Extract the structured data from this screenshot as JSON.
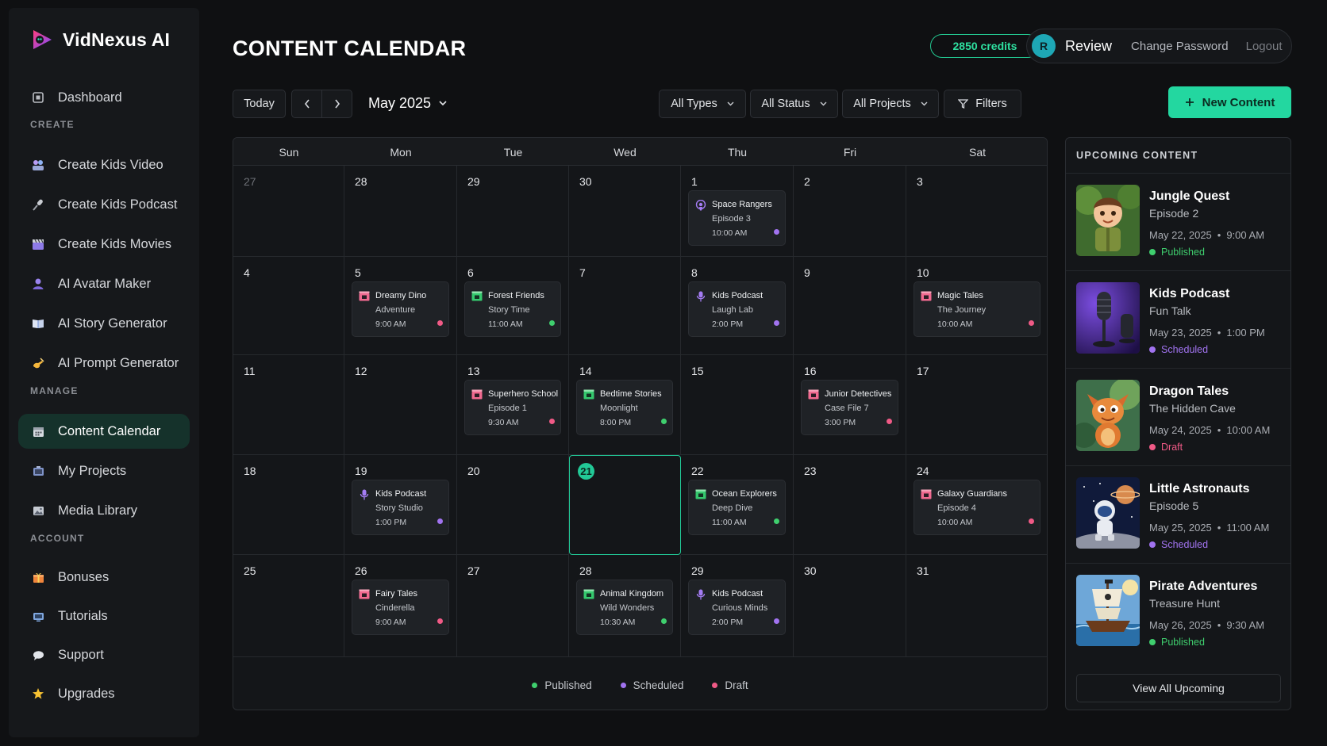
{
  "app": {
    "name": "VidNexus AI"
  },
  "sidebar": {
    "dashboard": {
      "label": "Dashboard",
      "icon": "dashboard-icon"
    },
    "sections": {
      "create": "CREATE",
      "manage": "MANAGE",
      "account": "ACCOUNT"
    },
    "create_items": [
      {
        "label": "Create Kids Video",
        "icon": "kids-video-icon"
      },
      {
        "label": "Create Kids Podcast",
        "icon": "podcast-icon"
      },
      {
        "label": "Create Kids Movies",
        "icon": "clapper-icon"
      },
      {
        "label": "AI Avatar Maker",
        "icon": "avatar-icon"
      },
      {
        "label": "AI Story Generator",
        "icon": "book-icon"
      },
      {
        "label": "AI Prompt Generator",
        "icon": "hand-write-icon"
      }
    ],
    "manage_items": [
      {
        "label": "Content Calendar",
        "icon": "calendar-icon",
        "active": true
      },
      {
        "label": "My Projects",
        "icon": "projects-icon"
      },
      {
        "label": "Media Library",
        "icon": "image-icon"
      }
    ],
    "account_items": [
      {
        "label": "Bonuses",
        "icon": "gift-icon"
      },
      {
        "label": "Tutorials",
        "icon": "tv-icon"
      },
      {
        "label": "Support",
        "icon": "chat-icon"
      },
      {
        "label": "Upgrades",
        "icon": "star-icon"
      }
    ]
  },
  "header": {
    "title": "CONTENT CALENDAR",
    "credits": "2850 credits",
    "avatar_initial": "R",
    "user": "Review",
    "change_password": "Change Password",
    "logout": "Logout"
  },
  "toolbar": {
    "today": "Today",
    "month": "May 2025",
    "types": "All Types",
    "status": "All Status",
    "projects": "All Projects",
    "filters": "Filters",
    "new_content": "New Content"
  },
  "calendar": {
    "weekdays": [
      "Sun",
      "Mon",
      "Tue",
      "Wed",
      "Thu",
      "Fri",
      "Sat"
    ],
    "weeks": [
      [
        "27",
        "28",
        "29",
        "30",
        "1",
        "2",
        "3"
      ],
      [
        "4",
        "5",
        "6",
        "7",
        "8",
        "9",
        "10"
      ],
      [
        "11",
        "12",
        "13",
        "14",
        "15",
        "16",
        "17"
      ],
      [
        "18",
        "19",
        "20",
        "21",
        "22",
        "23",
        "24"
      ],
      [
        "25",
        "26",
        "27",
        "28",
        "29",
        "30",
        "31"
      ]
    ],
    "today": "21",
    "events": [
      {
        "week": 0,
        "day": 4,
        "title": "Space Rangers",
        "subtitle": "Episode 3",
        "time": "10:00 AM",
        "type": "podcast",
        "status": "scheduled"
      },
      {
        "week": 1,
        "day": 1,
        "title": "Dreamy Dino",
        "subtitle": "Adventure",
        "time": "9:00 AM",
        "type": "video",
        "status": "draft"
      },
      {
        "week": 1,
        "day": 2,
        "title": "Forest Friends",
        "subtitle": "Story Time",
        "time": "11:00 AM",
        "type": "story",
        "status": "published"
      },
      {
        "week": 1,
        "day": 4,
        "title": "Kids Podcast",
        "subtitle": "Laugh Lab",
        "time": "2:00 PM",
        "type": "mic",
        "status": "scheduled"
      },
      {
        "week": 1,
        "day": 6,
        "title": "Magic Tales",
        "subtitle": "The Journey",
        "time": "10:00 AM",
        "type": "video",
        "status": "draft"
      },
      {
        "week": 2,
        "day": 2,
        "title": "Superhero School",
        "subtitle": "Episode 1",
        "time": "9:30 AM",
        "type": "video",
        "status": "draft"
      },
      {
        "week": 2,
        "day": 3,
        "title": "Bedtime Stories",
        "subtitle": "Moonlight",
        "time": "8:00 PM",
        "type": "story",
        "status": "published"
      },
      {
        "week": 2,
        "day": 5,
        "title": "Junior Detectives",
        "subtitle": "Case File 7",
        "time": "3:00 PM",
        "type": "video",
        "status": "draft"
      },
      {
        "week": 3,
        "day": 1,
        "title": "Kids Podcast",
        "subtitle": "Story Studio",
        "time": "1:00 PM",
        "type": "mic",
        "status": "scheduled"
      },
      {
        "week": 3,
        "day": 4,
        "title": "Ocean Explorers",
        "subtitle": "Deep Dive",
        "time": "11:00 AM",
        "type": "story",
        "status": "published"
      },
      {
        "week": 3,
        "day": 6,
        "title": "Galaxy Guardians",
        "subtitle": "Episode 4",
        "time": "10:00 AM",
        "type": "video",
        "status": "draft"
      },
      {
        "week": 4,
        "day": 1,
        "title": "Fairy Tales",
        "subtitle": "Cinderella",
        "time": "9:00 AM",
        "type": "video",
        "status": "draft"
      },
      {
        "week": 4,
        "day": 3,
        "title": "Animal Kingdom",
        "subtitle": "Wild Wonders",
        "time": "10:30 AM",
        "type": "story",
        "status": "published"
      },
      {
        "week": 4,
        "day": 4,
        "title": "Kids Podcast",
        "subtitle": "Curious Minds",
        "time": "2:00 PM",
        "type": "mic",
        "status": "scheduled"
      }
    ],
    "legend": {
      "published": "Published",
      "scheduled": "Scheduled",
      "draft": "Draft"
    }
  },
  "upcoming": {
    "heading": "UPCOMING CONTENT",
    "items": [
      {
        "title": "Jungle Quest",
        "subtitle": "Episode 2",
        "date": "May 22, 2025",
        "time": "9:00 AM",
        "status": "Published",
        "thumb": "boy-explorer"
      },
      {
        "title": "Kids Podcast",
        "subtitle": "Fun Talk",
        "date": "May 23, 2025",
        "time": "1:00 PM",
        "status": "Scheduled",
        "thumb": "microphone"
      },
      {
        "title": "Dragon Tales",
        "subtitle": "The Hidden Cave",
        "date": "May 24, 2025",
        "time": "10:00 AM",
        "status": "Draft",
        "thumb": "dragon"
      },
      {
        "title": "Little Astronauts",
        "subtitle": "Episode 5",
        "date": "May 25, 2025",
        "time": "11:00 AM",
        "status": "Scheduled",
        "thumb": "astronaut"
      },
      {
        "title": "Pirate Adventures",
        "subtitle": "Treasure Hunt",
        "date": "May 26, 2025",
        "time": "9:30 AM",
        "status": "Published",
        "thumb": "pirate-ship"
      }
    ],
    "view_all": "View All Upcoming"
  },
  "colors": {
    "accent": "#23d7a0",
    "published": "#3fcf6e",
    "scheduled": "#a173f0",
    "draft": "#f05a86",
    "video_icon": "#f06a90",
    "story_icon": "#35c96e",
    "mic_icon": "#a47cf3"
  }
}
